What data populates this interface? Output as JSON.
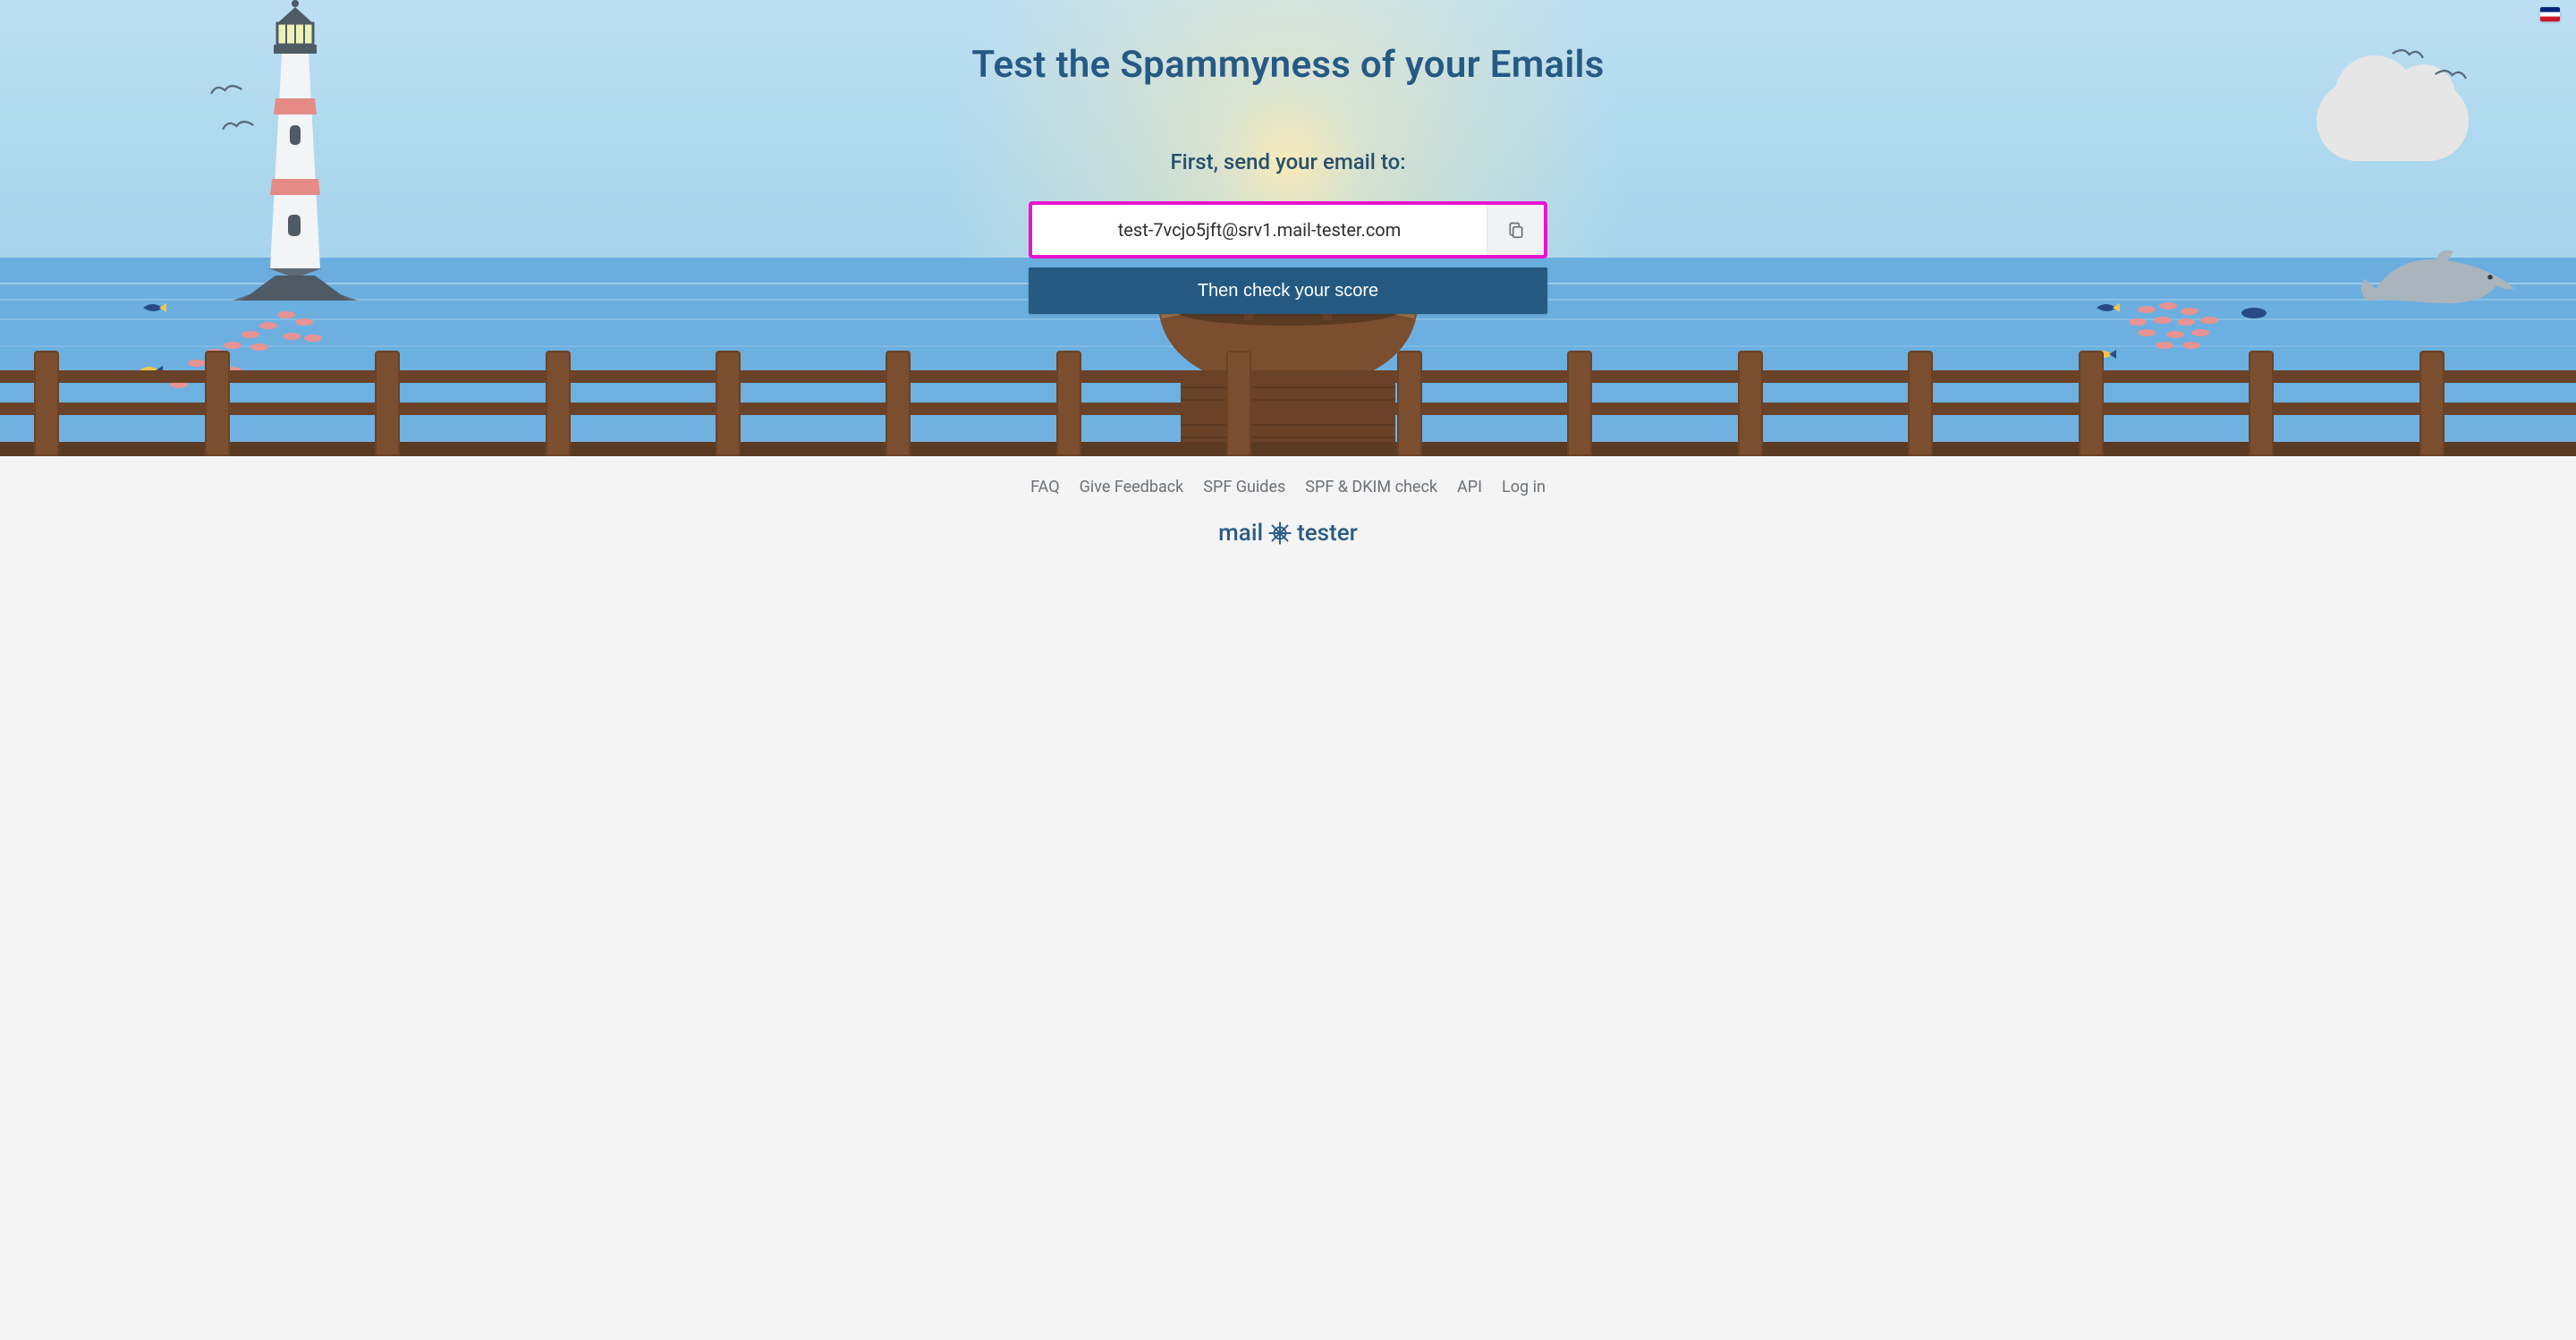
{
  "hero": {
    "title": "Test the Spammyness of your Emails",
    "subtitle": "First, send your email to:",
    "email_address": "test-7vcjo5jft@srv1.mail-tester.com",
    "check_button_label": "Then check your score"
  },
  "language": {
    "current": "en-GB"
  },
  "footer": {
    "links": [
      {
        "label": "FAQ"
      },
      {
        "label": "Give Feedback"
      },
      {
        "label": "SPF Guides"
      },
      {
        "label": "SPF & DKIM check"
      },
      {
        "label": "API"
      },
      {
        "label": "Log in"
      }
    ],
    "logo_left": "mail",
    "logo_right": "tester"
  }
}
